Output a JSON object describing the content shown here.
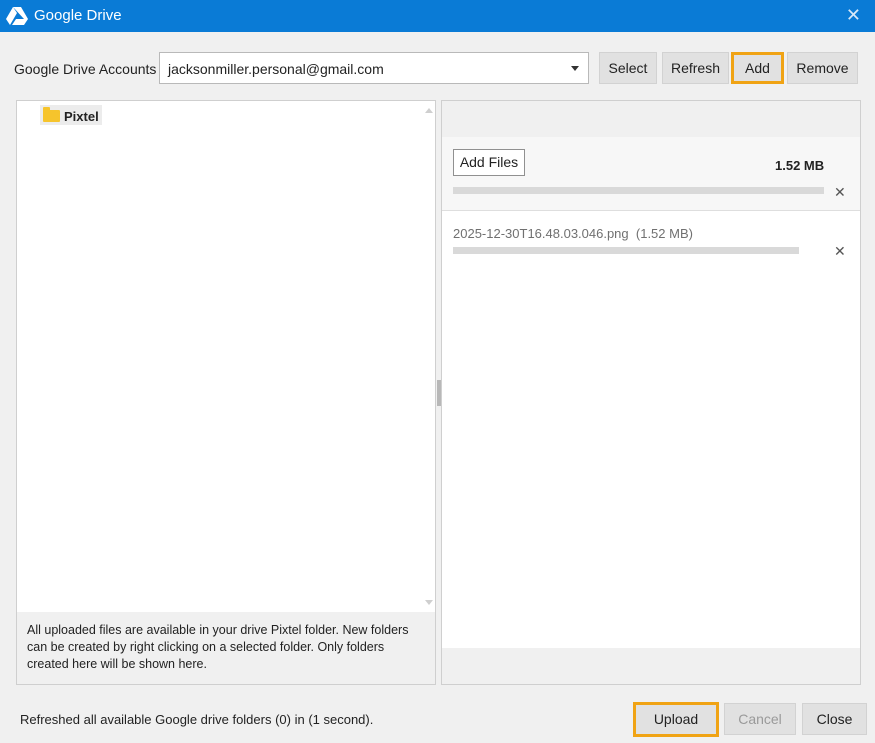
{
  "window": {
    "title": "Google Drive",
    "close_glyph": "✕"
  },
  "accounts": {
    "label": "Google Drive Accounts",
    "selected": "jacksonmiller.personal@gmail.com",
    "buttons": {
      "select": "Select",
      "refresh": "Refresh",
      "add": "Add",
      "remove": "Remove"
    }
  },
  "tree": {
    "folders": [
      {
        "name": "Pixtel"
      }
    ]
  },
  "info_text": "All uploaded files are available in your drive Pixtel folder. New folders can be created by right clicking on a selected folder. Only folders created here will be shown here.",
  "upload_panel": {
    "add_files_label": "Add Files",
    "total_size": "1.52 MB",
    "files": [
      {
        "name": "2025-12-30T16.48.03.046.png",
        "size": "(1.52 MB)"
      }
    ]
  },
  "status": "Refreshed all available Google drive folders (0) in (1 second).",
  "footer_buttons": {
    "upload": "Upload",
    "cancel": "Cancel",
    "close": "Close"
  },
  "colors": {
    "titlebar": "#0a7bd6",
    "highlight": "#f0a314",
    "folder": "#f6c42c"
  }
}
